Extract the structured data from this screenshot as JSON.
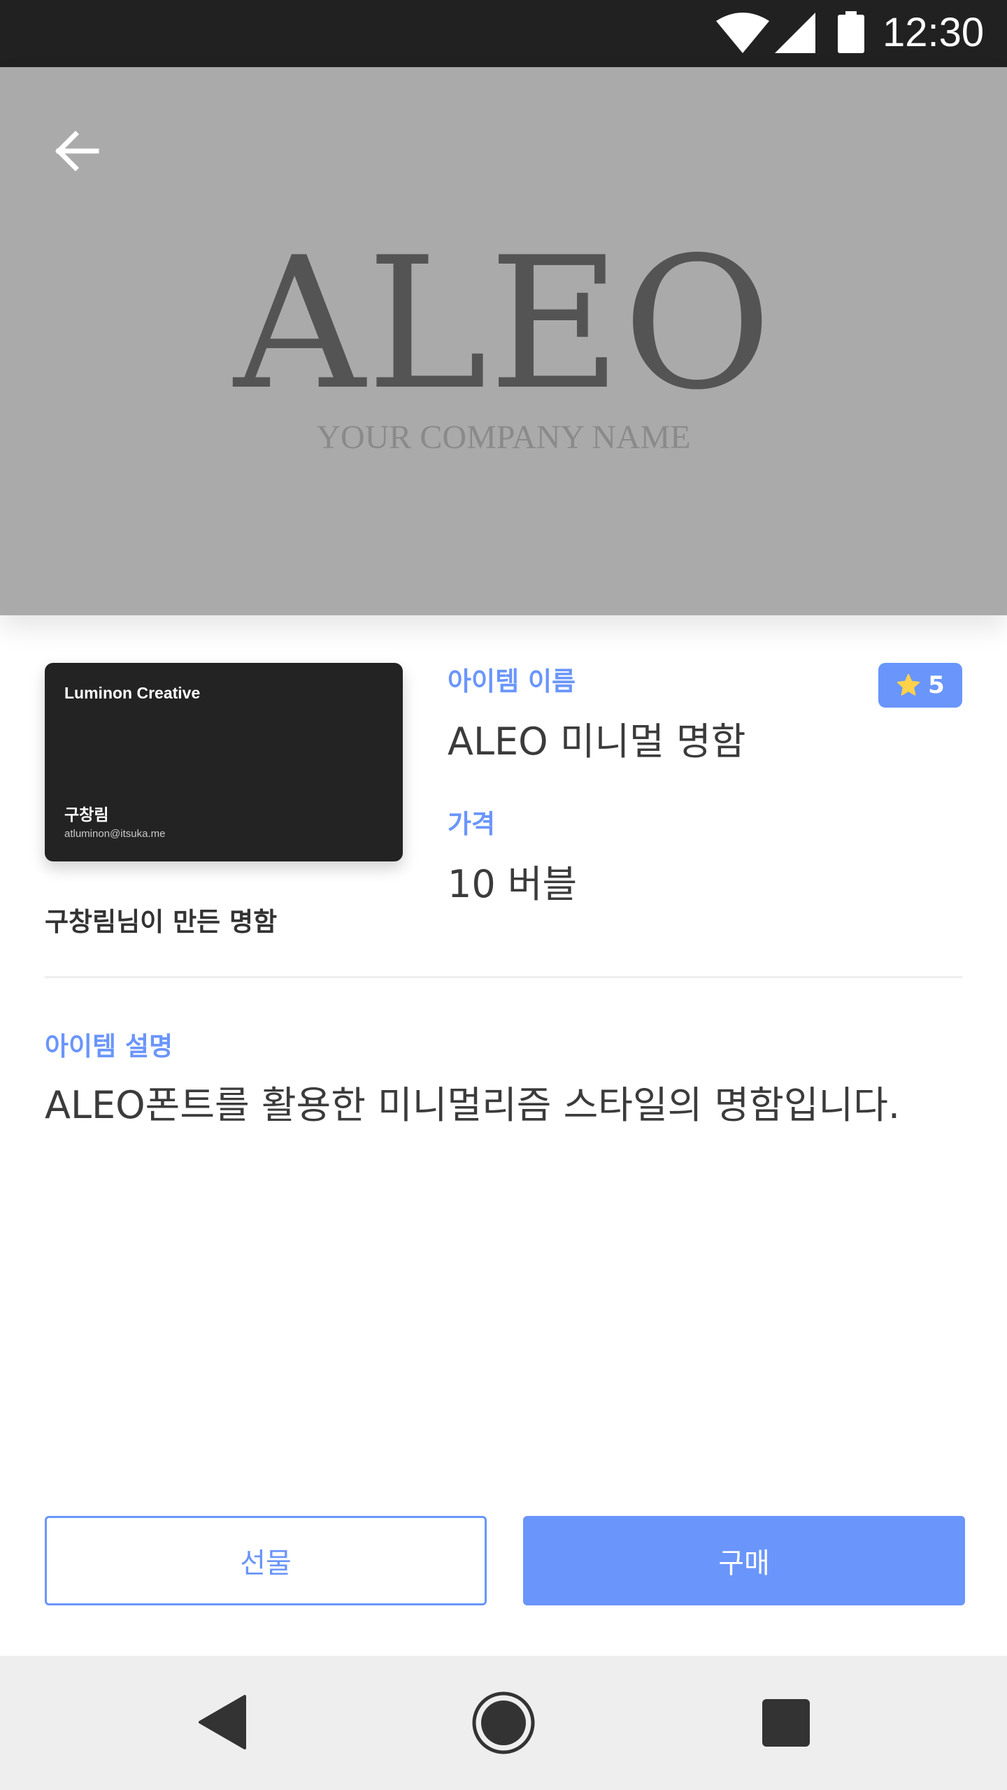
{
  "status_bar": {
    "time": "12:30",
    "icons": [
      "wifi-icon",
      "signal-icon",
      "battery-icon"
    ],
    "background_color": "#212121"
  },
  "hero": {
    "logo_text": "ALEO",
    "subtitle": "YOUR COMPANY NAME",
    "background_color": "#aaaaaa",
    "back_icon": "arrow-left-icon"
  },
  "card_preview": {
    "company": "Luminon Creative",
    "person": "구창림",
    "email": "atluminon@itsuka.me",
    "background_color": "#232323"
  },
  "creator_text": "구창림님이 만든 명함",
  "item": {
    "name_label": "아이템 이름",
    "name": "ALEO 미니멀 명함",
    "price_label": "가격",
    "price": "10 버블",
    "description_label": "아이템 설명",
    "description": "ALEO폰트를 활용한 미니멀리즘 스타일의 명함입니다."
  },
  "rating": {
    "icon": "star-icon",
    "value": "5"
  },
  "buttons": {
    "gift_label": "선물",
    "buy_label": "구매"
  },
  "colors": {
    "accent": "#6a95fb",
    "star": "#ffd24a"
  },
  "nav_bar": {
    "icons": [
      "nav-back-icon",
      "nav-home-icon",
      "nav-recents-icon"
    ]
  }
}
